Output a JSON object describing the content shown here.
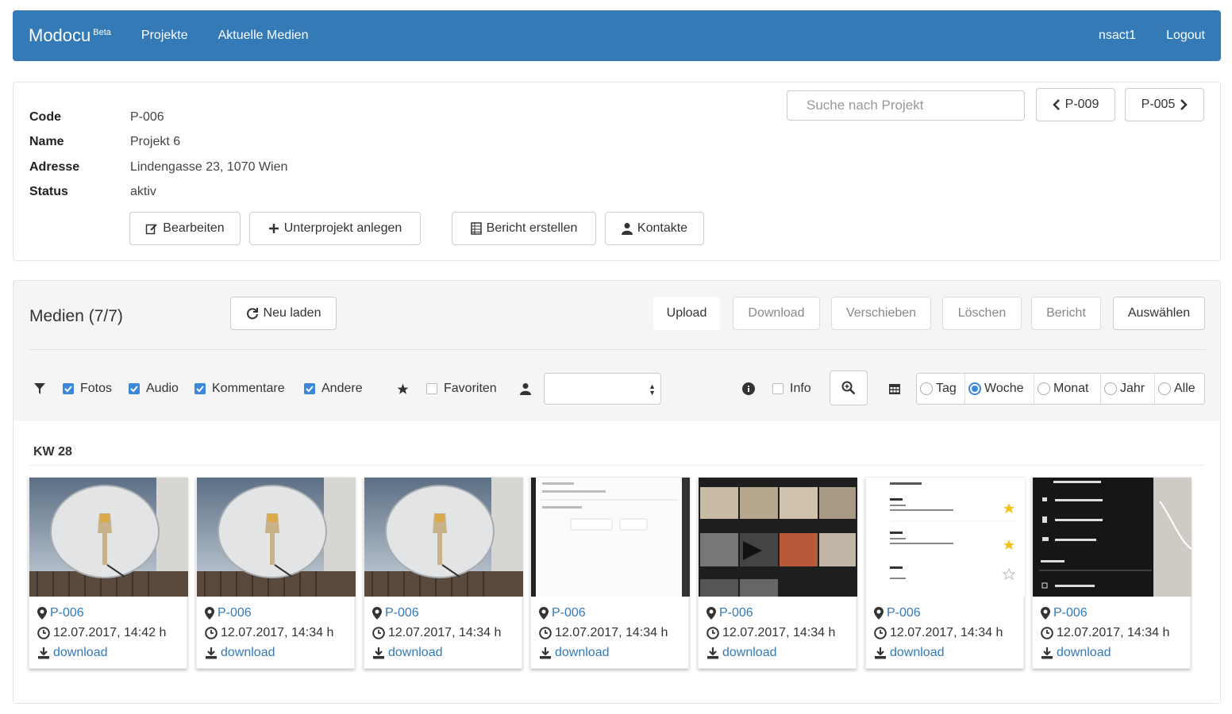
{
  "navbar": {
    "brand": "Modocu",
    "brand_badge": "Beta",
    "links": [
      "Projekte",
      "Aktuelle Medien"
    ],
    "user": "nsact1",
    "logout": "Logout",
    "color": "#337ab7"
  },
  "project": {
    "fields": [
      {
        "label": "Code",
        "value": "P-006"
      },
      {
        "label": "Name",
        "value": "Projekt 6"
      },
      {
        "label": "Adresse",
        "value": "Lindengasse 23, 1070 Wien"
      },
      {
        "label": "Status",
        "value": "aktiv"
      }
    ],
    "search_placeholder": "Suche nach Projekt",
    "prev_label": "P-009",
    "next_label": "P-005",
    "actions": {
      "edit": "Bearbeiten",
      "subproject": "Unterprojekt anlegen",
      "report": "Bericht erstellen",
      "contacts": "Kontakte"
    }
  },
  "media": {
    "title": "Medien (7/7)",
    "reload": "Neu laden",
    "toolbar": {
      "upload": "Upload",
      "download": "Download",
      "move": "Verschieben",
      "delete": "Löschen",
      "report": "Bericht",
      "select": "Auswählen"
    },
    "filters": {
      "photos": "Fotos",
      "audio": "Audio",
      "comments": "Kommentare",
      "other": "Andere",
      "favorites": "Favoriten",
      "info": "Info",
      "user_select_value": ""
    },
    "periods": [
      "Tag",
      "Woche",
      "Monat",
      "Jahr",
      "Alle"
    ],
    "selected_period": "Woche",
    "week_label": "KW 28",
    "items": [
      {
        "project": "P-006",
        "timestamp": "12.07.2017, 14:42 h",
        "download": "download",
        "thumb": "dish"
      },
      {
        "project": "P-006",
        "timestamp": "12.07.2017, 14:34 h",
        "download": "download",
        "thumb": "dish"
      },
      {
        "project": "P-006",
        "timestamp": "12.07.2017, 14:34 h",
        "download": "download",
        "thumb": "dish"
      },
      {
        "project": "P-006",
        "timestamp": "12.07.2017, 14:34 h",
        "download": "download",
        "thumb": "list-screen"
      },
      {
        "project": "P-006",
        "timestamp": "12.07.2017, 14:34 h",
        "download": "download",
        "thumb": "gallery-screen"
      },
      {
        "project": "P-006",
        "timestamp": "12.07.2017, 14:34 h",
        "download": "download",
        "thumb": "projects-screen"
      },
      {
        "project": "P-006",
        "timestamp": "12.07.2017, 14:34 h",
        "download": "download",
        "thumb": "menu-screen"
      }
    ]
  }
}
